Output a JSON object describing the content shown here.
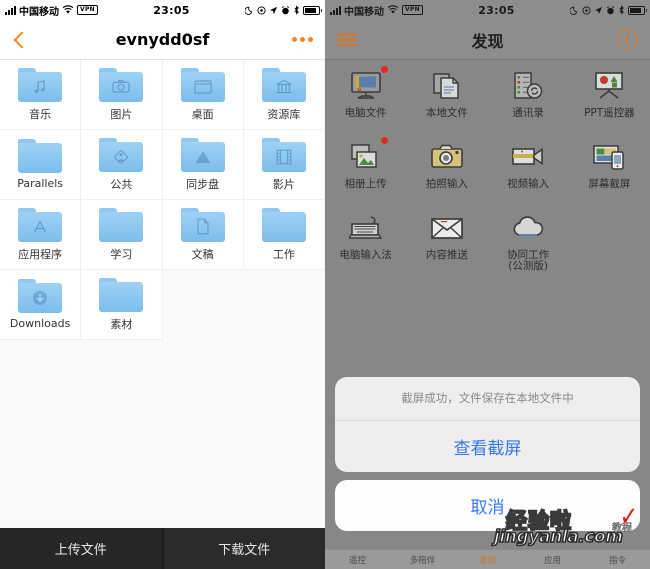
{
  "left_phone": {
    "status_bar": {
      "carrier": "中国移动",
      "vpn": "VPN",
      "time": "23:05",
      "icons": [
        "signal-icon",
        "wifi-icon",
        "vpn-icon",
        "moon-icon",
        "at-icon",
        "location-arrow-icon",
        "alarm-icon",
        "bluetooth-icon",
        "battery-icon"
      ]
    },
    "nav": {
      "back_icon": "back-chevron-icon",
      "title": "evnydd0sf",
      "more_icon": "more-dots-icon"
    },
    "folders": [
      {
        "label": "音乐",
        "glyph": "music-note-icon"
      },
      {
        "label": "图片",
        "glyph": "camera-icon"
      },
      {
        "label": "桌面",
        "glyph": "window-icon"
      },
      {
        "label": "资源库",
        "glyph": "bank-icon"
      },
      {
        "label": "Parallels",
        "glyph": "plain-icon"
      },
      {
        "label": "公共",
        "glyph": "share-icon"
      },
      {
        "label": "同步盘",
        "glyph": "drive-icon"
      },
      {
        "label": "影片",
        "glyph": "film-icon"
      },
      {
        "label": "应用程序",
        "glyph": "apps-icon"
      },
      {
        "label": "学习",
        "glyph": "plain-icon"
      },
      {
        "label": "文稿",
        "glyph": "document-icon"
      },
      {
        "label": "工作",
        "glyph": "plain-icon"
      },
      {
        "label": "Downloads",
        "glyph": "download-icon"
      },
      {
        "label": "素材",
        "glyph": "plain-icon"
      }
    ],
    "bottom_buttons": [
      {
        "label": "上传文件"
      },
      {
        "label": "下载文件"
      }
    ]
  },
  "right_phone": {
    "status_bar": {
      "carrier": "中国移动",
      "vpn": "VPN",
      "time": "23:05"
    },
    "nav": {
      "menu_icon": "hamburger-icon",
      "title": "发现",
      "info_icon": "info-circle-icon",
      "info_glyph": "i"
    },
    "apps": [
      {
        "label": "电脑文件",
        "glyph": "desktop-monitor-icon",
        "badge": true
      },
      {
        "label": "本地文件",
        "glyph": "documents-stack-icon",
        "badge": false
      },
      {
        "label": "通讯录",
        "glyph": "contacts-sync-icon",
        "badge": false
      },
      {
        "label": "PPT遥控器",
        "glyph": "presentation-screen-icon",
        "badge": false
      },
      {
        "label": "相册上传",
        "glyph": "photo-stack-icon",
        "badge": true
      },
      {
        "label": "拍照输入",
        "glyph": "photo-camera-icon",
        "badge": false
      },
      {
        "label": "视频输入",
        "glyph": "video-camera-icon",
        "badge": false
      },
      {
        "label": "屏幕截屏",
        "glyph": "screen-phone-icon",
        "badge": false
      },
      {
        "label": "电脑输入法",
        "glyph": "keyboard-icon",
        "badge": false
      },
      {
        "label": "内容推送",
        "glyph": "envelope-icon",
        "badge": false
      },
      {
        "label": "协同工作\n(公测版)",
        "glyph": "cloud-icon",
        "badge": false
      }
    ],
    "action_sheet": {
      "message": "截屏成功，文件保存在本地文件中",
      "primary_action": "查看截屏",
      "cancel_action": "取消"
    },
    "tab_bar": [
      {
        "label": "遥控",
        "active": false
      },
      {
        "label": "多陪伴",
        "active": false
      },
      {
        "label": "发现",
        "active": true
      },
      {
        "label": "应用",
        "active": false
      },
      {
        "label": "指令",
        "active": false
      }
    ]
  },
  "watermark": {
    "brand": "经验啦",
    "url": "jingyanla.com",
    "check": "✓",
    "sub": "教程"
  }
}
